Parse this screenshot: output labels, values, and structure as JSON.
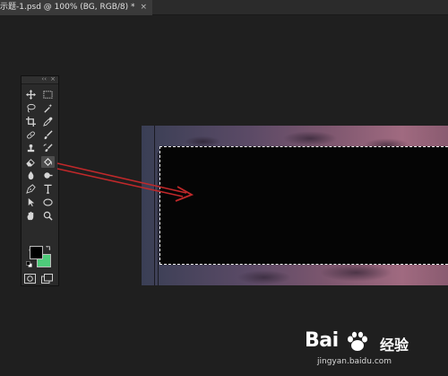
{
  "document_tab": {
    "title": "示题-1.psd @ 100% (BG, RGB/8) *",
    "close": "×"
  },
  "tools_panel": {
    "collapse_glyph": "‹‹",
    "close_glyph": "×",
    "more_glyph": "•••",
    "tools": [
      {
        "name": "move-tool",
        "icon": "move-icon"
      },
      {
        "name": "marquee-tool",
        "icon": "rect-marquee-icon"
      },
      {
        "name": "lasso-tool",
        "icon": "lasso-icon"
      },
      {
        "name": "magic-wand-tool",
        "icon": "magic-wand-icon"
      },
      {
        "name": "crop-tool",
        "icon": "crop-icon"
      },
      {
        "name": "eyedropper-tool",
        "icon": "eyedropper-icon"
      },
      {
        "name": "healing-brush-tool",
        "icon": "bandage-icon"
      },
      {
        "name": "brush-tool",
        "icon": "brush-icon"
      },
      {
        "name": "clone-stamp-tool",
        "icon": "stamp-icon"
      },
      {
        "name": "history-brush-tool",
        "icon": "history-brush-icon"
      },
      {
        "name": "eraser-tool",
        "icon": "eraser-icon"
      },
      {
        "name": "paint-bucket-tool",
        "icon": "paint-bucket-icon",
        "active": true
      },
      {
        "name": "blur-tool",
        "icon": "blur-drop-icon"
      },
      {
        "name": "dodge-tool",
        "icon": "dodge-icon"
      },
      {
        "name": "pen-tool",
        "icon": "pen-icon"
      },
      {
        "name": "type-tool",
        "icon": "type-icon"
      },
      {
        "name": "path-selection-tool",
        "icon": "arrow-icon"
      },
      {
        "name": "ellipse-tool",
        "icon": "ellipse-icon"
      },
      {
        "name": "hand-tool",
        "icon": "hand-icon"
      },
      {
        "name": "zoom-tool",
        "icon": "zoom-icon"
      }
    ],
    "foreground_color": "#000000",
    "background_color": "#4ecb7a"
  },
  "canvas": {
    "selection_fill": "#050505"
  },
  "annotation": {
    "arrow_color": "#c0282a"
  },
  "watermark": {
    "logo": "Bai",
    "cn": "经验",
    "url": "jingyan.baidu.com"
  }
}
